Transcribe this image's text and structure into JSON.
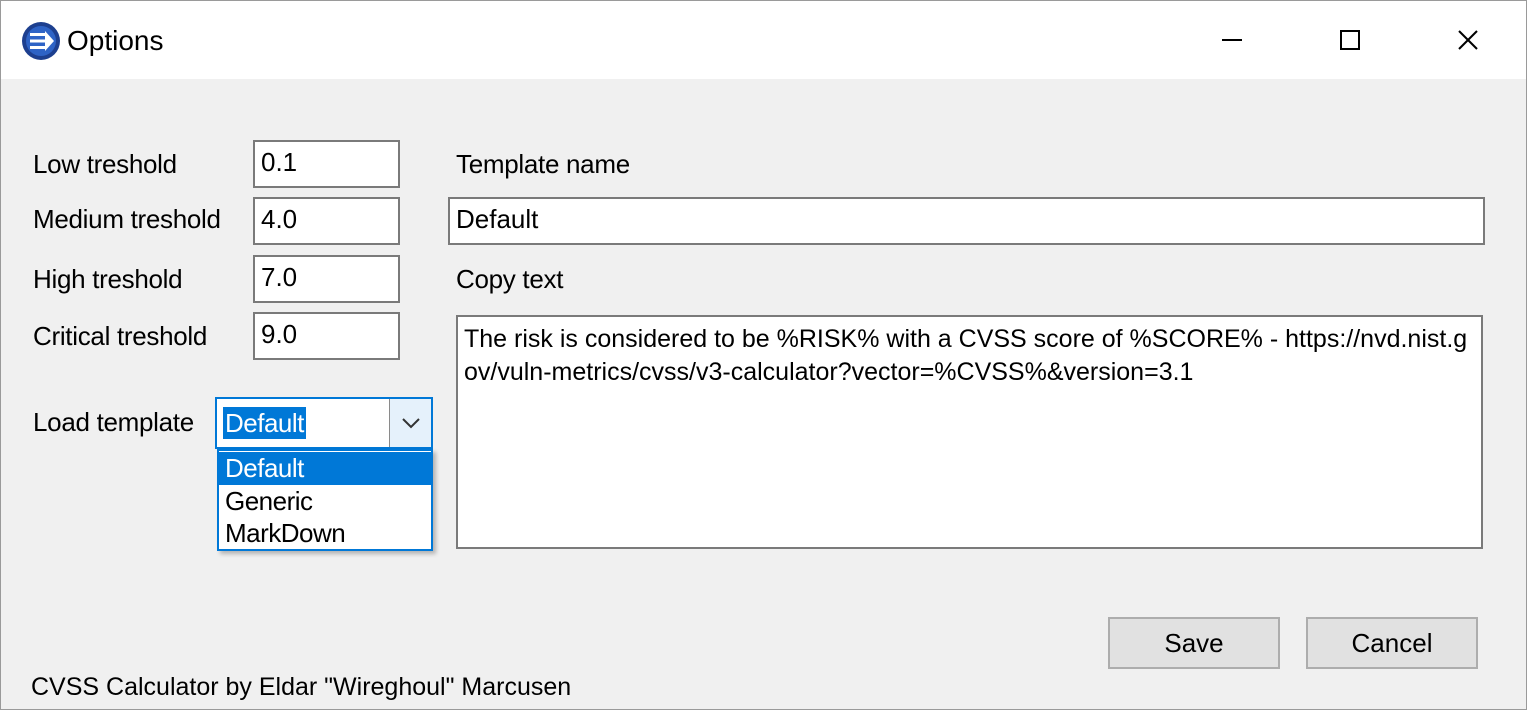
{
  "window": {
    "title": "Options",
    "icon": "cvss-app-icon",
    "controls": [
      "minimize-icon",
      "maximize-icon",
      "close-icon"
    ]
  },
  "thresholds": {
    "low": {
      "label": "Low treshold",
      "value": "0.1"
    },
    "medium": {
      "label": "Medium treshold",
      "value": "4.0"
    },
    "high": {
      "label": "High treshold",
      "value": "7.0"
    },
    "critical": {
      "label": "Critical treshold",
      "value": "9.0"
    }
  },
  "load_template": {
    "label": "Load template",
    "selected": "Default",
    "options": [
      "Default",
      "Generic",
      "MarkDown"
    ]
  },
  "template_name": {
    "label": "Template name",
    "value": "Default"
  },
  "copy_text": {
    "label": "Copy text",
    "value": "The risk is considered to be %RISK% with a CVSS score of %SCORE% - https://nvd.nist.gov/vuln-metrics/cvss/v3-calculator?vector=%CVSS%&version=3.1"
  },
  "buttons": {
    "save": "Save",
    "cancel": "Cancel"
  },
  "footer": "CVSS Calculator by Eldar \"Wireghoul\" Marcusen",
  "colors": {
    "accent": "#0078d7",
    "window_bg": "#f0f0f0",
    "titlebar_bg": "#ffffff"
  }
}
